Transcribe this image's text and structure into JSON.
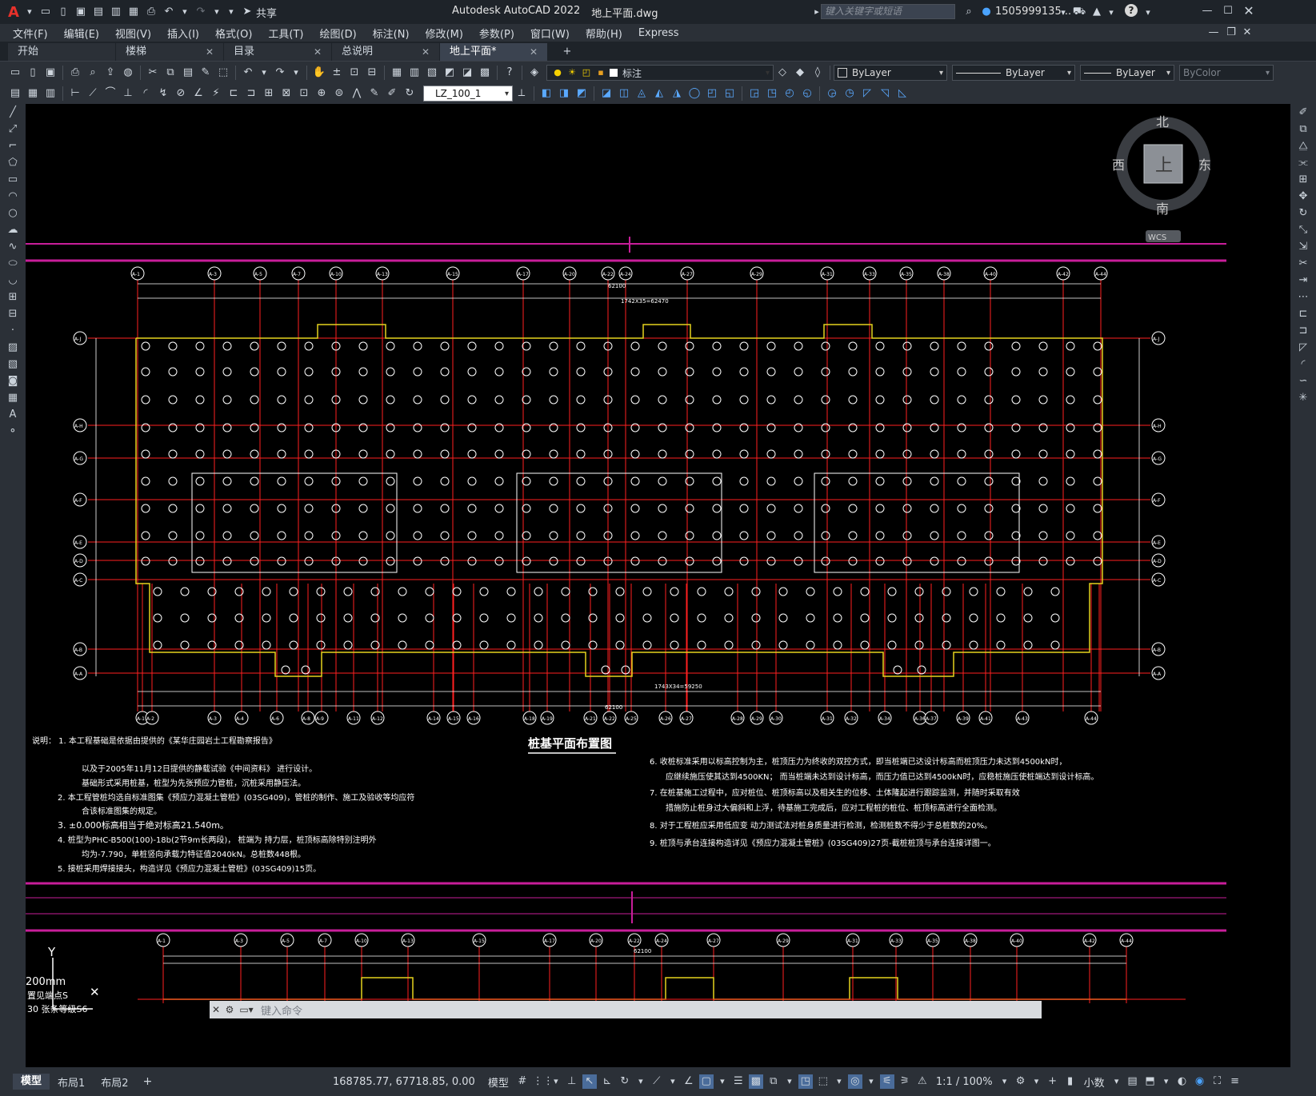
{
  "titlebar": {
    "app_logo": "A",
    "share_label": "共享",
    "app_title": "Autodesk AutoCAD 2022",
    "file_name": "地上平面.dwg",
    "search_placeholder": "键入关键字或短语",
    "user_name": "1505999135...",
    "help_icon": "?"
  },
  "menubar": {
    "items": [
      "文件(F)",
      "编辑(E)",
      "视图(V)",
      "插入(I)",
      "格式(O)",
      "工具(T)",
      "绘图(D)",
      "标注(N)",
      "修改(M)",
      "参数(P)",
      "窗口(W)",
      "帮助(H)",
      "Express"
    ]
  },
  "doctabs": {
    "tabs": [
      {
        "label": "开始"
      },
      {
        "label": "楼梯"
      },
      {
        "label": "目录"
      },
      {
        "label": "总说明"
      },
      {
        "label": "地上平面*"
      }
    ],
    "add_label": "+"
  },
  "ribbon": {
    "layer_name": "标注",
    "color": "ByLayer",
    "linetype": "ByLayer",
    "lineweight": "ByLayer",
    "plotstyle": "ByColor",
    "dim_style": "LZ_100_1"
  },
  "viewcube": {
    "north": "北",
    "south": "南",
    "east": "东",
    "west": "西",
    "top": "上",
    "wcs": "WCS"
  },
  "drawing": {
    "title": "桩基平面布置图",
    "top_dim_total": "62100",
    "top_dim_sub": "1742X35=62470",
    "bottom_dim_total": "62100",
    "bottom_dim_sub": "1743X34=59250",
    "notes_left": [
      "说明： 1.  本工程基础是依据由提供的《某华庄园岩土工程勘察报告》",
      "以及于2005年11月12日提供的静载试验《中间资料》                          进行设计。",
      "基础形式采用桩基，桩型为先张预应力管桩，沉桩采用静压法。",
      "2.  本工程管桩均选自标准图集《预应力混凝土管桩》(03SG409)，管桩的制作、施工及验收等均应符",
      "合该标准图集的规定。",
      "3.  ±0.000标高相当于绝对标高21.540m。",
      "4.  桩型为PHC-B500(100)-18b(2节9m长两段)，          桩端为          持力层，桩顶标高除特别注明外",
      "均为-7.790，单桩竖向承载力特征值2040kN。总桩数448根。",
      "5.  接桩采用焊接接头，构造详见《预应力混凝土管桩》(03SG409)15页。"
    ],
    "notes_right": [
      "6.  收桩标准采用以标高控制为主，桩顶压力为终收的双控方式，即当桩端已达设计标高而桩顶压力未达到4500kN时，",
      "应继续施压使其达到4500KN；     而当桩端未达到设计标高，而压力值已达到4500kN时，应稳桩施压使桩端达到设计标高。",
      "7.  在桩基施工过程中，应对桩位、桩顶标高以及相关生的位移、土体隆起进行跟踪监测，并随时采取有效",
      "措施防止桩身过大偏斜和上浮，待基施工完成后，应对工程桩的桩位、桩顶标高进行全面检测。",
      "8.  对于工程桩应采用低应变        动力测试法对桩身质量进行检测，检测桩数不得少于总桩数的20%。",
      "9.  桩顶与承台连接构造详见《预应力混凝土管桩》(03SG409)27页-截桩桩顶与承台连接详图一。"
    ],
    "bottom_dim_total2": "62100"
  },
  "axis_labels_top": [
    "A-1",
    "A-3",
    "A-5",
    "A-7",
    "A-10",
    "A-13",
    "A-15",
    "A-17",
    "A-20",
    "A-22",
    "A-24",
    "A-27",
    "A-29",
    "A-31",
    "A-33",
    "A-35",
    "A-38",
    "A-40",
    "A-42",
    "A-44"
  ],
  "axis_labels_bottom": [
    "A-1",
    "A-2",
    "A-3",
    "A-4",
    "A-6",
    "A-8",
    "A-9",
    "A-11",
    "A-12",
    "A-14",
    "A-15",
    "A-16",
    "A-18",
    "A-19",
    "A-21",
    "A-22",
    "A-25",
    "A-26",
    "A-27",
    "A-28",
    "A-29",
    "A-30",
    "A-31",
    "A-32",
    "A-34",
    "A-36",
    "A-37",
    "A-39",
    "A-41",
    "A-43",
    "A-44"
  ],
  "axis_labels_left": [
    "A-J",
    "A-H",
    "A-G",
    "A-F",
    "A-E",
    "A-D",
    "A-C",
    "A-B",
    "A-A"
  ],
  "command_area": {
    "ucs_y": "Y",
    "ucs_scale": "200mm",
    "history1": "置见端点S",
    "history2": "30 张条等级S6",
    "cmd_placeholder": "键入命令"
  },
  "status": {
    "layout_tabs": [
      "模型",
      "布局1",
      "布局2"
    ],
    "add_layout": "+",
    "coords": "168785.77, 67718.85, 0.00",
    "model_label": "模型",
    "scale": "1:1 / 100%",
    "units": "小数"
  },
  "colors": {
    "accent_magenta": "#c81e9a",
    "axis_red": "#ff2020",
    "outline_yellow": "#e6d21e",
    "pile_white": "#ffffff",
    "cad_bg": "#000000"
  }
}
